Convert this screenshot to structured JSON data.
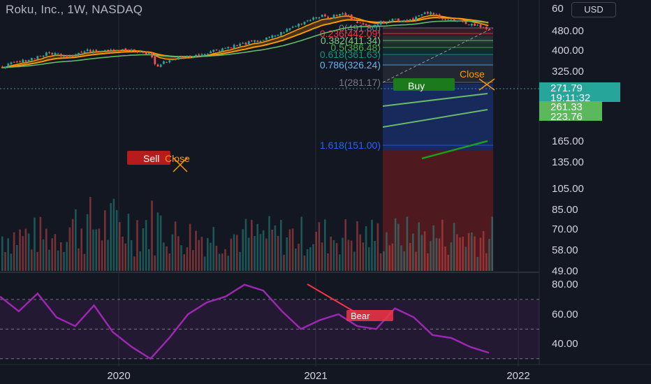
{
  "header": {
    "title": "Roku, Inc., 1W, NASDAQ",
    "currency": "USD"
  },
  "colors": {
    "background": "#131722",
    "up": "#26a69a",
    "down": "#ef5350",
    "ema_fast": "#ff9800",
    "ema_slow": "#66bb6a",
    "rsi": "#9c27b0",
    "long_profit": "#1e3a8a",
    "long_loss": "#7f1d1d",
    "buy_label": "#1b7a1b",
    "sell_label": "#b71c1c"
  },
  "chart_data": [
    {
      "type": "candlestick",
      "price_axis": {
        "scale": "log",
        "range": [
          49,
          600
        ],
        "tick_labels": [
          "60",
          "480.00",
          "400.00",
          "325.00",
          "165.00",
          "135.00",
          "105.00",
          "85.00",
          "70.00",
          "58.00",
          "49.00"
        ]
      },
      "time_axis": {
        "tick_labels": [
          "2020",
          "2021",
          "2022"
        ]
      },
      "last_price_labels": [
        {
          "text": "271.79",
          "color": "#26a69a"
        },
        {
          "text": "19:11:32",
          "color": "#26a69a"
        },
        {
          "text": "261.33",
          "color": "#5cb85c"
        },
        {
          "text": "223.76",
          "color": "#5cb85c"
        }
      ],
      "fibonacci_levels": [
        {
          "label": "0(491.80)",
          "ratio": 0,
          "value": 491.8,
          "color": "#787b86"
        },
        {
          "label": "0.236(442.09)",
          "ratio": 0.236,
          "value": 442.09,
          "color": "#f23645"
        },
        {
          "label": "0.382(411.34)",
          "ratio": 0.382,
          "value": 411.34,
          "color": "#81c784"
        },
        {
          "label": "0.5(386.48)",
          "ratio": 0.5,
          "value": 386.48,
          "color": "#4caf50"
        },
        {
          "label": "0.618(361.63)",
          "ratio": 0.618,
          "value": 361.63,
          "color": "#089981"
        },
        {
          "label": "0.786(326.24)",
          "ratio": 0.786,
          "value": 326.24,
          "color": "#64b5f6"
        },
        {
          "label": "1(281.17)",
          "ratio": 1,
          "value": 281.17,
          "color": "#787b86"
        },
        {
          "label": "1.618(151.00)",
          "ratio": 1.618,
          "value": 151.0,
          "color": "#2962ff"
        }
      ],
      "signals": [
        {
          "label": "Sell",
          "kind": "sell"
        },
        {
          "label": "Close",
          "kind": "close"
        },
        {
          "label": "Buy",
          "kind": "buy"
        },
        {
          "label": "Close",
          "kind": "close"
        }
      ]
    },
    {
      "type": "line",
      "series": [
        {
          "name": "",
          "values": [
            72,
            62,
            74,
            58,
            52,
            66,
            48,
            38,
            30,
            44,
            60,
            68,
            72,
            80,
            76,
            62,
            50,
            56,
            60,
            52,
            50,
            64,
            58,
            46,
            44,
            38,
            34
          ]
        }
      ],
      "y_axis": {
        "range": [
          28,
          86
        ],
        "tick_labels": [
          "80.00",
          "60.00",
          "40.00"
        ]
      },
      "bands": [
        30,
        50,
        70
      ],
      "annotations": [
        {
          "label": "Bear"
        }
      ]
    }
  ]
}
